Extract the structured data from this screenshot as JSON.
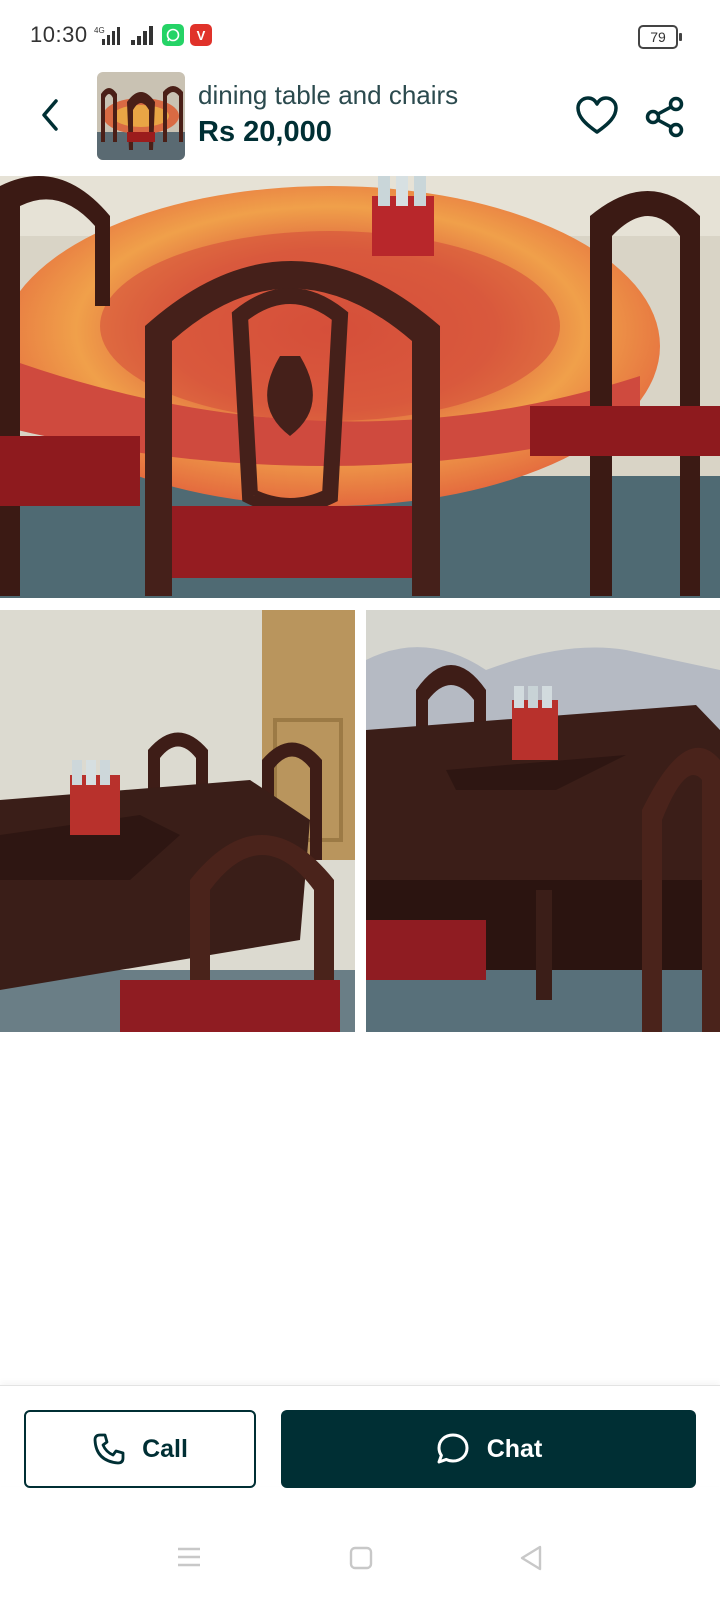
{
  "status_bar": {
    "time": "10:30",
    "network": "4G",
    "battery": "79",
    "whatsapp_color": "#25d366",
    "app_badge_color": "#e0322a",
    "app_badge_letter": "V"
  },
  "header": {
    "title": "dining table and chairs",
    "price": "Rs 20,000",
    "back_icon": "chevron-left-icon",
    "favorite_icon": "heart-outline-icon",
    "share_icon": "share-icon"
  },
  "gallery": {
    "image_count": 4
  },
  "actions": {
    "call_label": "Call",
    "call_icon": "phone-icon",
    "chat_label": "Chat",
    "chat_icon": "chat-bubble-icon",
    "primary_color": "#002f34"
  },
  "nav_bar": {
    "menu_icon": "menu-icon",
    "home_icon": "square-home-icon",
    "back_icon": "triangle-back-icon"
  }
}
